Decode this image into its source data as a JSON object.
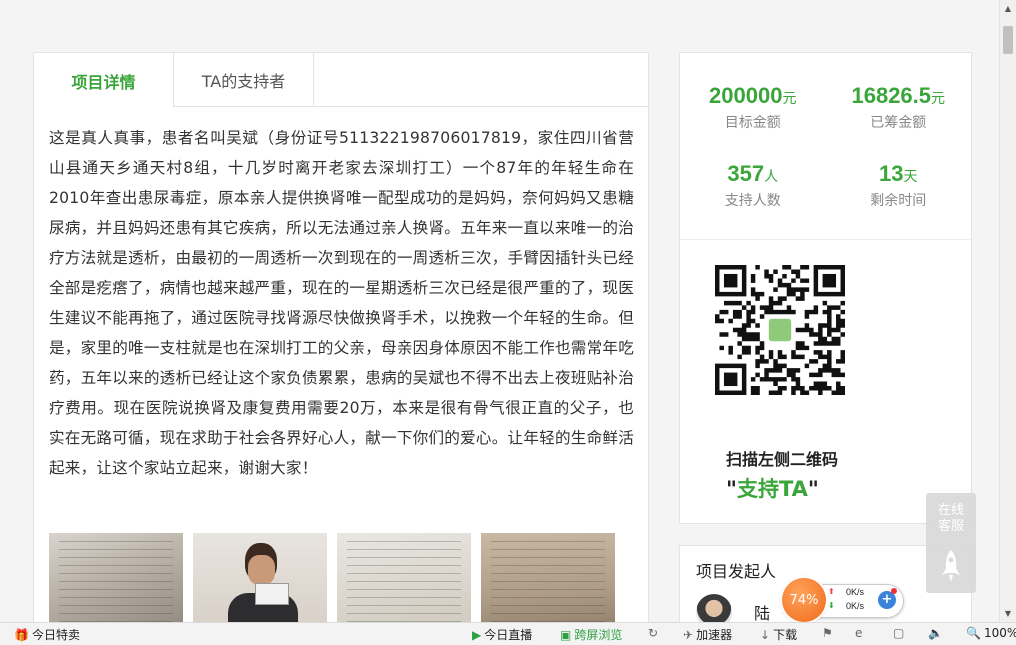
{
  "tabs": [
    {
      "label": "项目详情",
      "active": true
    },
    {
      "label": "TA的支持者",
      "active": false
    }
  ],
  "story": "这是真人真事，患者名叫吴斌（身份证号511322198706017819，家住四川省营山县通天乡通天村8组，十几岁时离开老家去深圳打工）一个87年的年轻生命在2010年查出患尿毒症，原本亲人提供换肾唯一配型成功的是妈妈，奈何妈妈又患糖尿病，并且妈妈还患有其它疾病，所以无法通过亲人换肾。五年来一直以来唯一的治疗方法就是透析，由最初的一周透析一次到现在的一周透析三次，手臂因插针头已经全部是疙瘩了，病情也越来越严重，现在的一星期透析三次已经是很严重的了，现医生建议不能再拖了，通过医院寻找肾源尽快做换肾手术，以挽救一个年轻的生命。但是，家里的唯一支柱就是也在深圳打工的父亲，母亲因身体原因不能工作也需常年吃药，五年以来的透析已经让这个家负债累累，患病的吴斌也不得不出去上夜班贴补治疗费用。现在医院说换肾及康复费用需要20万，本来是很有骨气很正直的父子，也实在无路可循，现在求助于社会各界好心人，献一下你们的爱心。让年轻的生命鲜活起来，让这个家站立起来，谢谢大家！",
  "stats": {
    "target": {
      "value": "200000",
      "unit": "元",
      "label": "目标金额"
    },
    "raised": {
      "value": "16826.5",
      "unit": "元",
      "label": "已筹金额"
    },
    "supporters": {
      "value": "357",
      "unit": "人",
      "label": "支持人数"
    },
    "remaining": {
      "value": "13",
      "unit": "天",
      "label": "剩余时间"
    }
  },
  "qr": {
    "caption": "扫描左侧二维码",
    "cta_open": "\"",
    "cta": "支持TA",
    "cta_close": "\""
  },
  "initiator": {
    "title": "项目发起人",
    "name": "陆"
  },
  "service": {
    "label_line1": "在线",
    "label_line2": "客服"
  },
  "speed_widget": {
    "percent": "74%",
    "up": "0K/s",
    "down": "0K/s"
  },
  "statusbar": {
    "deals": "今日特卖",
    "live": "今日直播",
    "cross_screen": "跨屏浏览",
    "accelerator": "加速器",
    "download": "下载",
    "zoom": "100%"
  },
  "colors": {
    "accent": "#3aa63a",
    "text": "#333333",
    "muted": "#888888"
  }
}
